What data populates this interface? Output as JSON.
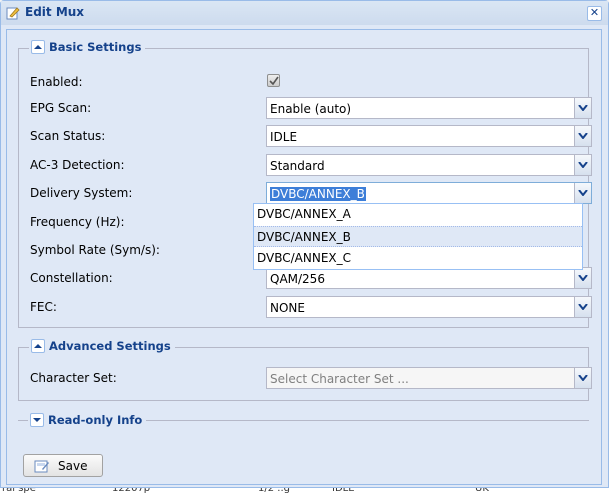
{
  "window": {
    "title": "Edit Mux",
    "close_symbol": "✕"
  },
  "basic": {
    "legend": "Basic Settings",
    "fields": {
      "enabled": {
        "label": "Enabled:",
        "checked": true
      },
      "epg_scan": {
        "label": "EPG Scan:",
        "value": "Enable (auto)"
      },
      "scan_status": {
        "label": "Scan Status:",
        "value": "IDLE"
      },
      "ac3": {
        "label": "AC-3 Detection:",
        "value": "Standard"
      },
      "delivery": {
        "label": "Delivery System:",
        "value": "DVBC/ANNEX_B"
      },
      "frequency": {
        "label": "Frequency (Hz):"
      },
      "symbol_rate": {
        "label": "Symbol Rate (Sym/s):"
      },
      "constellation": {
        "label": "Constellation:",
        "value": "QAM/256"
      },
      "fec": {
        "label": "FEC:",
        "value": "NONE"
      }
    },
    "delivery_options": [
      "DVBC/ANNEX_A",
      "DVBC/ANNEX_B",
      "DVBC/ANNEX_C"
    ]
  },
  "advanced": {
    "legend": "Advanced Settings",
    "charset": {
      "label": "Character Set:",
      "placeholder": "Select Character Set ..."
    }
  },
  "readonly": {
    "legend": "Read-only Info"
  },
  "save_button": {
    "label": "Save"
  },
  "background_row": [
    "ral spe",
    "12207p",
    "1/2 ..g",
    "IDLE",
    "UK"
  ],
  "colors": {
    "accent": "#15428b",
    "panel": "#dfe8f6",
    "border": "#99bbe8",
    "selection": "#3d7ed8"
  }
}
